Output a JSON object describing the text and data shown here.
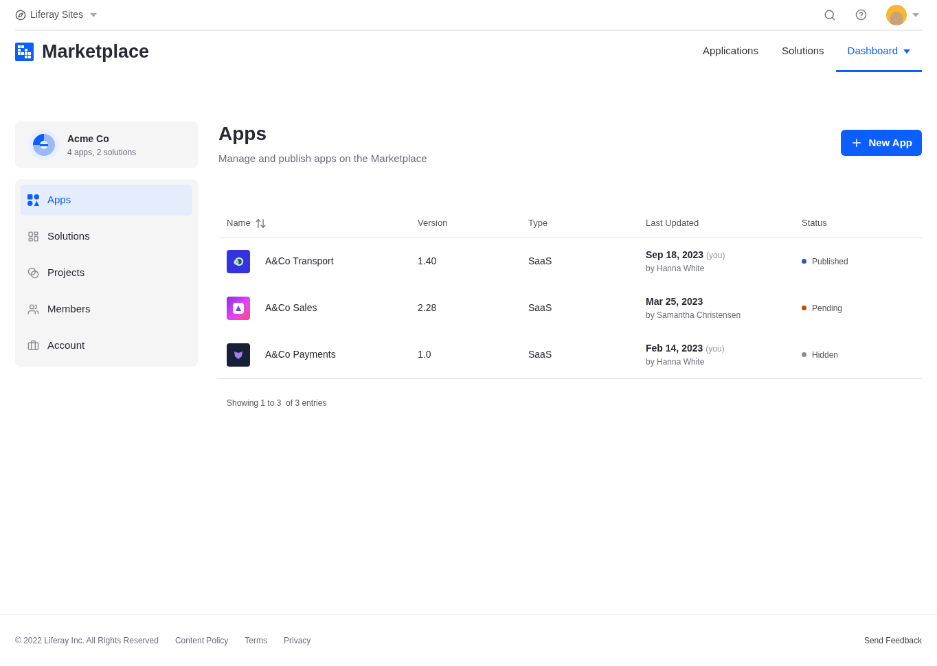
{
  "topbar": {
    "site": "Liferay Sites"
  },
  "header": {
    "title": "Marketplace",
    "nav": [
      {
        "label": "Applications",
        "selected": false,
        "dropdown": false
      },
      {
        "label": "Solutions",
        "selected": false,
        "dropdown": false
      },
      {
        "label": "Dashboard",
        "selected": true,
        "dropdown": true
      }
    ]
  },
  "account": {
    "name": "Acme Co",
    "summary": "4 apps, 2 solutions"
  },
  "sidebar": {
    "items": [
      {
        "label": "Apps",
        "selected": true
      },
      {
        "label": "Solutions",
        "selected": false
      },
      {
        "label": "Projects",
        "selected": false
      },
      {
        "label": "Members",
        "selected": false
      },
      {
        "label": "Account",
        "selected": false
      }
    ]
  },
  "page": {
    "title": "Apps",
    "subtitle": "Manage and publish apps on the Marketplace",
    "new_button": "New App"
  },
  "table": {
    "columns": [
      "Name",
      "Version",
      "Type",
      "Last Updated",
      "Status"
    ],
    "rows": [
      {
        "name": "A&Co Transport",
        "version": "1.40",
        "type": "SaaS",
        "date": "Sep 18, 2023",
        "note": "(you)",
        "author": "by Hanna White",
        "status": "Published",
        "color": "#2e5aac"
      },
      {
        "name": "A&Co Sales",
        "version": "2.28",
        "type": "SaaS",
        "date": "Mar 25, 2023",
        "author": "by Samantha Christensen",
        "status": "Pending",
        "color": "#b95000"
      },
      {
        "name": "A&Co Payments",
        "version": "1.0",
        "type": "SaaS",
        "date": "Feb 14, 2023",
        "note": "(you)",
        "author": "by Hanna White",
        "status": "Hidden",
        "color": "#8b8b94"
      }
    ]
  },
  "pagination": {
    "summary": "Showing 1 to 3  of 3 entries"
  },
  "footer": {
    "copyright": "© 2022 Liferay Inc. All Rights Reserved",
    "links": [
      "Content Policy",
      "Terms",
      "Privacy"
    ],
    "feedback": "Send Feedback"
  }
}
